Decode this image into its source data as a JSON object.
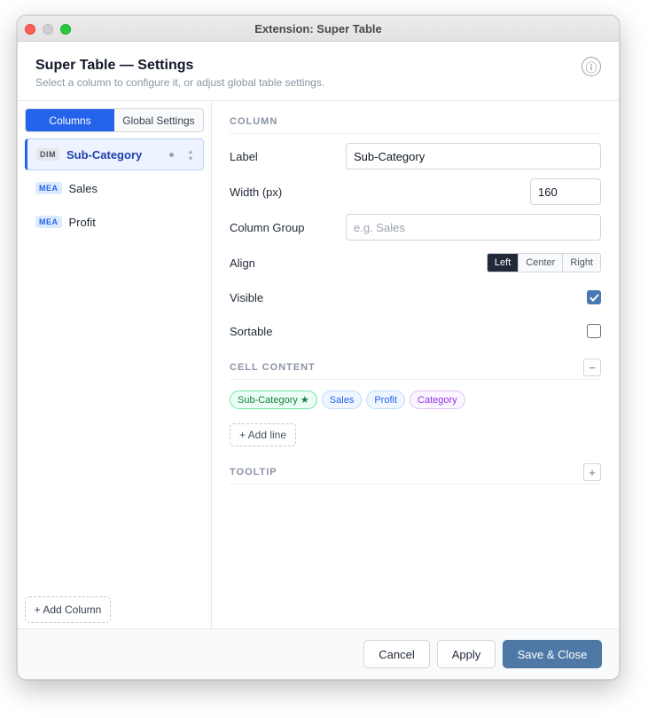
{
  "window": {
    "title": "Extension: Super Table"
  },
  "header": {
    "title": "Super Table — Settings",
    "subtitle": "Select a column to configure it, or adjust global table settings.",
    "info_icon": "ⓘ"
  },
  "sidebar": {
    "tabs": [
      {
        "label": "Columns",
        "active": true
      },
      {
        "label": "Global Settings",
        "active": false
      }
    ],
    "columns": [
      {
        "tag": "DIM",
        "name": "Sub-Category",
        "selected": true
      },
      {
        "tag": "MEA",
        "name": "Sales",
        "selected": false
      },
      {
        "tag": "MEA",
        "name": "Profit",
        "selected": false
      }
    ],
    "add_column_label": "+ Add Column"
  },
  "column_section": {
    "heading": "COLUMN",
    "label_label": "Label",
    "label_value": "Sub-Category",
    "width_label": "Width (px)",
    "width_value": "160",
    "group_label": "Column Group",
    "group_placeholder": "e.g. Sales",
    "align_label": "Align",
    "align_options": [
      "Left",
      "Center",
      "Right"
    ],
    "align_selected": "Left",
    "visible_label": "Visible",
    "visible_checked": true,
    "sortable_label": "Sortable",
    "sortable_checked": false
  },
  "cell_content": {
    "heading": "CELL CONTENT",
    "collapse_symbol": "−",
    "chips": [
      {
        "label": "Sub-Category ★",
        "color": "green"
      },
      {
        "label": "Sales",
        "color": "blue"
      },
      {
        "label": "Profit",
        "color": "blue"
      },
      {
        "label": "Category",
        "color": "purple"
      }
    ],
    "add_line_label": "+ Add line"
  },
  "tooltip": {
    "heading": "TOOLTIP",
    "expand_symbol": "+"
  },
  "footer": {
    "cancel_label": "Cancel",
    "apply_label": "Apply",
    "save_label": "Save & Close"
  },
  "colors": {
    "accent": "#2563eb",
    "primary_button": "#4e79a7",
    "checkbox": "#4a78b0"
  }
}
